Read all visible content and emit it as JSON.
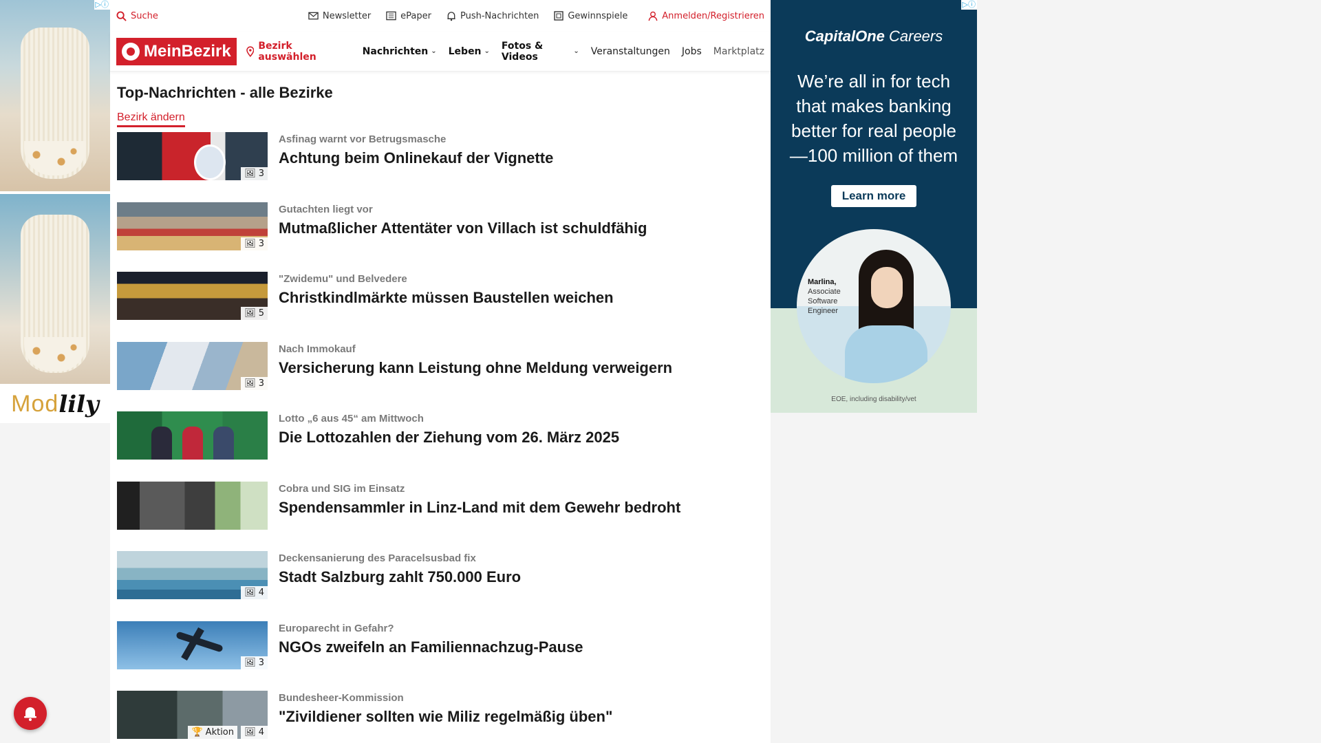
{
  "left_ad": {
    "brand_part1": "Mod",
    "brand_part2": "lily",
    "adchoice": "▷ⓘ"
  },
  "utility_bar": {
    "search_label": "Suche",
    "newsletter_label": "Newsletter",
    "epaper_label": "ePaper",
    "push_label": "Push-Nachrichten",
    "gewinnspiele_label": "Gewinnspiele",
    "login_label": "Anmelden/Registrieren"
  },
  "nav": {
    "brand": "MeinBezirk",
    "region_label": "Bezirk auswählen",
    "items": [
      {
        "label": "Nachrichten"
      },
      {
        "label": "Leben"
      },
      {
        "label": "Fotos & Videos"
      },
      {
        "label": "Veranstaltungen"
      },
      {
        "label": "Jobs"
      },
      {
        "label": "Marktplatz"
      }
    ]
  },
  "section": {
    "title": "Top-Nachrichten - alle Bezirke",
    "change_link": "Bezirk ändern"
  },
  "articles": [
    {
      "kicker": "Asfinag warnt vor Betrugsmasche",
      "headline": "Achtung beim Onlinekauf der Vignette",
      "photos": "3"
    },
    {
      "kicker": "Gutachten liegt vor",
      "headline": "Mutmaßlicher Attentäter von Villach ist schuldfähig",
      "photos": "3"
    },
    {
      "kicker": "\"Zwidemu\" und Belvedere",
      "headline": "Christkindlmärkte müssen Baustellen weichen",
      "photos": "5"
    },
    {
      "kicker": "Nach Immokauf",
      "headline": "Versicherung kann Leistung ohne Meldung verweigern",
      "photos": "3"
    },
    {
      "kicker": "Lotto „6 aus 45“ am Mittwoch",
      "headline": "Die Lottozahlen der Ziehung vom 26. März 2025",
      "photos": ""
    },
    {
      "kicker": "Cobra und SIG im Einsatz",
      "headline": "Spendensammler in Linz-Land mit dem Gewehr bedroht",
      "photos": ""
    },
    {
      "kicker": "Deckensanierung des Paracelsusbad fix",
      "headline": "Stadt Salzburg zahlt 750.000 Euro",
      "photos": "4"
    },
    {
      "kicker": "Europarecht in Gefahr?",
      "headline": "NGOs zweifeln an Familiennachzug-Pause",
      "photos": "3"
    },
    {
      "kicker": "Bundesheer-Kommission",
      "headline": "\"Zivildiener sollten wie Miliz regelmäßig üben\"",
      "photos": "4",
      "aktion": "Aktion"
    }
  ],
  "right_ad": {
    "brand": "CapitalOne",
    "brand_suffix": "Careers",
    "headline": "We’re all in for tech that makes banking better for real people —100 million of them",
    "cta": "Learn more",
    "person_name": "Marlina,",
    "person_role1": "Associate",
    "person_role2": "Software",
    "person_role3": "Engineer",
    "footnote": "EOE, including disability/vet",
    "adchoice": "▷ⓘ"
  },
  "colors": {
    "brand_red": "#d3202b",
    "ad_navy": "#0b3a59"
  }
}
